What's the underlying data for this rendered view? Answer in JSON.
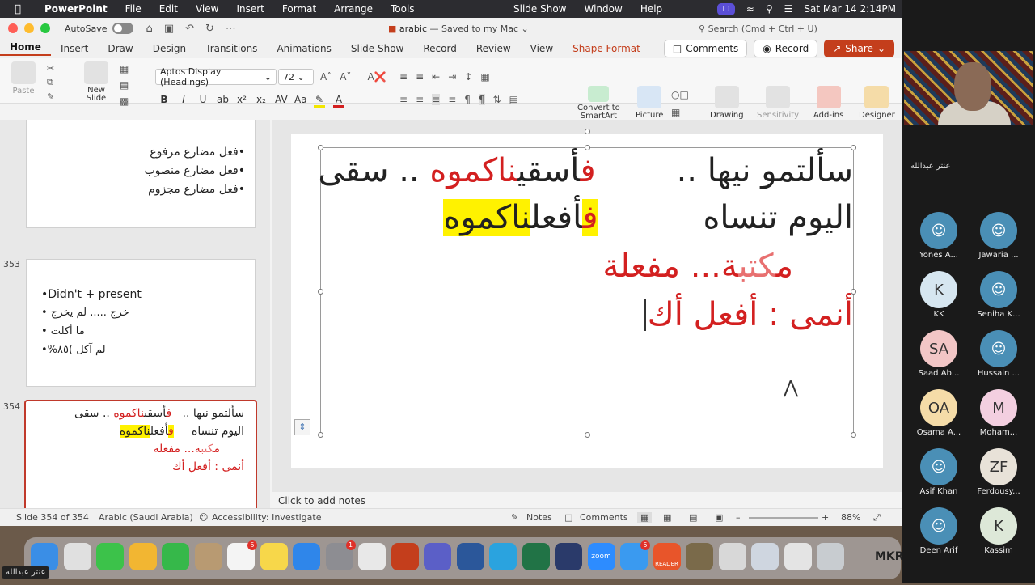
{
  "menubar": {
    "app": "PowerPoint",
    "items": [
      "File",
      "Edit",
      "View",
      "Insert",
      "Format",
      "Arrange",
      "Tools"
    ],
    "center": [
      "Slide Show",
      "Window",
      "Help"
    ],
    "datetime": "Sat Mar 14  2:14PM"
  },
  "titlebar": {
    "autosave": "AutoSave",
    "doc_name": "arabic",
    "doc_status": " — Saved to my Mac",
    "search_placeholder": "Search (Cmd + Ctrl + U)"
  },
  "tabs": [
    "Home",
    "Insert",
    "Draw",
    "Design",
    "Transitions",
    "Animations",
    "Slide Show",
    "Record",
    "Review",
    "View"
  ],
  "shape_tab": "Shape Format",
  "tab_buttons": {
    "comments": "Comments",
    "record": "Record",
    "share": "Share"
  },
  "ribbon": {
    "paste": "Paste",
    "new_slide": "New\nSlide",
    "font_name": "Aptos Display (Headings)",
    "font_size": "72",
    "convert": "Convert to\nSmartArt",
    "picture": "Picture",
    "drawing": "Drawing",
    "sensitivity": "Sensitivity",
    "addins": "Add-ins",
    "designer": "Designer"
  },
  "thumbnails": {
    "t352": [
      "•فعل مضارع مرفوع",
      "•فعل مضارع منصوب",
      "•فعل مضارع مجزوم"
    ],
    "t353_num": "353",
    "t353_en": "•Didn't + present",
    "t353_ar": [
      "خرج ..... لم يخرج •",
      "ما أكلت •",
      "لم آكل  )٨٥%•"
    ],
    "t354_num": "354"
  },
  "slide": {
    "l1_a": "سألتمو نيها  ..",
    "l1_b": "ف",
    "l1_c": "أسقي",
    "l1_d": "نا",
    "l1_e": "كم",
    "l1_f": "وه",
    "l1_g": "  .. سقى",
    "l2_a": "اليوم تنساه",
    "l2_b": "ف",
    "l2_c": "أفعل",
    "l2_d": "ناكموه",
    "l3_a": "م",
    "l3_b": "كتب",
    "l3_c": "ة... مفعلة",
    "l4": "أنمى : أفعل أك"
  },
  "notes_placeholder": "Click to add notes",
  "status": {
    "slide_count": "Slide 354 of 354",
    "language": "Arabic (Saudi Arabia)",
    "accessibility": "Accessibility: Investigate",
    "notes": "Notes",
    "comments": "Comments",
    "zoom": "88%"
  },
  "zoom_panel": {
    "speaker_name": "عنتر عبدالله",
    "participants": [
      {
        "name": "Yones A...",
        "initials": "",
        "color": "#4a8fb6"
      },
      {
        "name": "Jawaria ...",
        "initials": "",
        "color": "#4a8fb6"
      },
      {
        "name": "KK",
        "initials": "K",
        "color": "#d6e6f0"
      },
      {
        "name": "Seniha K...",
        "initials": "",
        "color": "#4a8fb6"
      },
      {
        "name": "Saad Ab...",
        "initials": "SA",
        "color": "#f2c6c6"
      },
      {
        "name": "Hussain ...",
        "initials": "",
        "color": "#4a8fb6"
      },
      {
        "name": "Osama A...",
        "initials": "OA",
        "color": "#f5dca8"
      },
      {
        "name": "Moham...",
        "initials": "M",
        "color": "#f3cfe0"
      },
      {
        "name": "Asif Khan",
        "initials": "",
        "color": "#4a8fb6"
      },
      {
        "name": "Ferdousy...",
        "initials": "ZF",
        "color": "#e8e2d8"
      },
      {
        "name": "Deen Arif",
        "initials": "",
        "color": "#4a8fb6"
      },
      {
        "name": "Kassim",
        "initials": "K",
        "color": "#dde8d8"
      }
    ],
    "caption": "عنتر عبدالله"
  },
  "dock": {
    "apps": [
      {
        "name": "finder",
        "color": "#3a8ee6"
      },
      {
        "name": "launchpad",
        "color": "#e0e0e0"
      },
      {
        "name": "messages",
        "color": "#3cc24a"
      },
      {
        "name": "photos",
        "color": "#f2b632"
      },
      {
        "name": "facetime",
        "color": "#36b84a"
      },
      {
        "name": "contacts",
        "color": "#b89a72"
      },
      {
        "name": "reminders",
        "color": "#f4f4f4",
        "badge": "5"
      },
      {
        "name": "notes",
        "color": "#f7d74a"
      },
      {
        "name": "app-store",
        "color": "#2f86ea"
      },
      {
        "name": "system-settings",
        "color": "#8d8d92",
        "badge": "1"
      },
      {
        "name": "chrome",
        "color": "#e8e8e8"
      },
      {
        "name": "powerpoint",
        "color": "#c43e1c"
      },
      {
        "name": "teams",
        "color": "#5b5fc7"
      },
      {
        "name": "word",
        "color": "#2b579a"
      },
      {
        "name": "telegram",
        "color": "#2aa3df"
      },
      {
        "name": "excel",
        "color": "#217346"
      },
      {
        "name": "vpn",
        "color": "#2a3a6a"
      },
      {
        "name": "zoom",
        "color": "#2d8cff"
      },
      {
        "name": "mail",
        "color": "#3a9af0",
        "badge": "5"
      },
      {
        "name": "reader",
        "color": "#e8552a"
      },
      {
        "name": "archive",
        "color": "#7a6a4a"
      },
      {
        "name": "keyboard",
        "color": "#d8d8d8"
      },
      {
        "name": "preview",
        "color": "#cfd6e0"
      },
      {
        "name": "script",
        "color": "#e4e4e4"
      },
      {
        "name": "trash",
        "color": "#c8ccd0"
      }
    ],
    "zoom_label": "zoom",
    "reader_label": "READER",
    "mkr": "MKR"
  }
}
